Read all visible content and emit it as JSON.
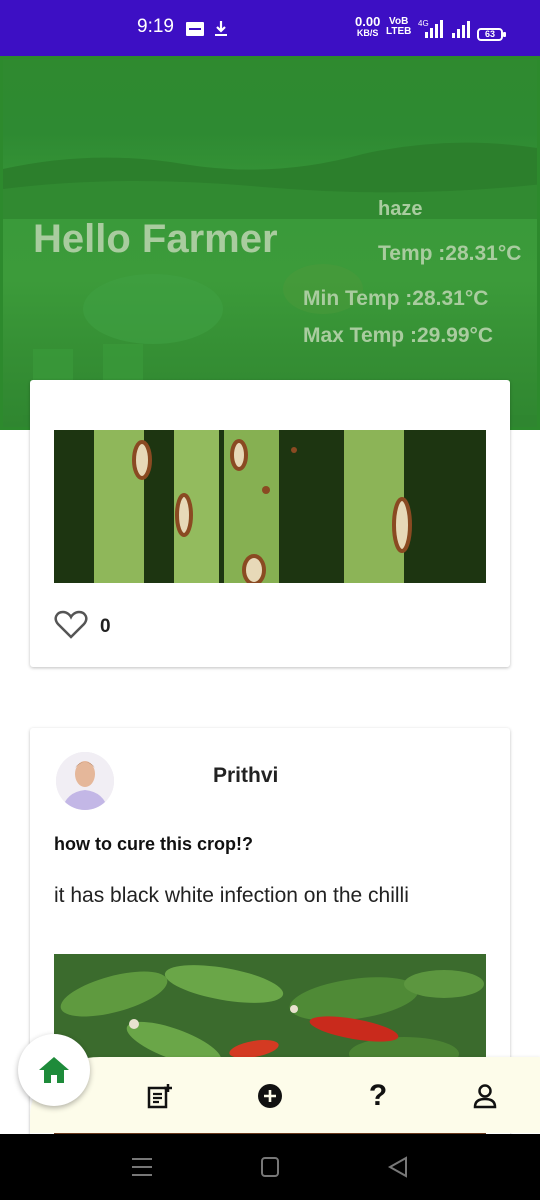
{
  "status_bar": {
    "time": "9:19",
    "network_speed_value": "0.00",
    "network_speed_unit": "KB/S",
    "volte_top": "VoB",
    "volte_bottom": "LTEB",
    "network_type": "4G",
    "battery": "63"
  },
  "header": {
    "greeting": "Hello Farmer",
    "weather_description": "haze",
    "temp": "Temp :28.31°C",
    "min_temp": "Min Temp :28.31°C",
    "max_temp": "Max Temp :29.99°C"
  },
  "posts": [
    {
      "likes": "0",
      "image_icon": "leaf-blight-photo"
    },
    {
      "author": "Prithvi",
      "title": "how to cure this crop!?",
      "body": "it has black white infection on the chilli",
      "image_icon": "chilli-plant-photo"
    }
  ],
  "bottom_nav": {
    "items": [
      {
        "icon": "home-icon",
        "active": true
      },
      {
        "icon": "new-post-icon"
      },
      {
        "icon": "add-circle-icon"
      },
      {
        "icon": "help-icon",
        "glyph": "?"
      },
      {
        "icon": "profile-icon"
      }
    ]
  },
  "colors": {
    "status_bar": "#3d0fc4",
    "header_green": "#2f8a2f",
    "header_text": "#a9cc9f",
    "nav_background": "#fdfcea",
    "home_icon": "#1e8b3a"
  }
}
